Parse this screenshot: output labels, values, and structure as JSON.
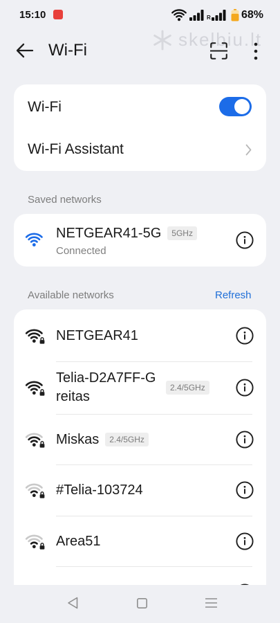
{
  "status_bar": {
    "time": "15:10",
    "roaming_label": "R",
    "battery_text": "68%",
    "battery_level": 0.68,
    "icons": [
      "notification-app-icon",
      "wifi-status-icon",
      "signal-icon",
      "signal-roaming-icon",
      "battery-icon"
    ]
  },
  "watermark": {
    "text": "skelbiu.lt"
  },
  "header": {
    "title": "Wi-Fi",
    "icons": [
      "back-arrow-icon",
      "scan-qr-icon",
      "more-vertical-icon"
    ]
  },
  "wifi_card": {
    "wifi_label": "Wi-Fi",
    "wifi_enabled": true,
    "assistant_label": "Wi-Fi Assistant"
  },
  "saved_networks": {
    "section_label": "Saved networks",
    "networks": [
      {
        "name": "NETGEAR41-5G",
        "band": "5GHz",
        "status": "Connected",
        "signal_level": 4,
        "secured": false
      }
    ]
  },
  "available_networks": {
    "section_label": "Available networks",
    "refresh_label": "Refresh",
    "networks": [
      {
        "name": "NETGEAR41",
        "signal_level": 4,
        "secured": true
      },
      {
        "name": "Telia-D2A7FF-Greitas",
        "band": "2.4/5GHz",
        "signal_level": 4,
        "secured": true
      },
      {
        "name": "Miskas",
        "band": "2.4/5GHz",
        "signal_level": 3,
        "secured": true
      },
      {
        "name": "#Telia-103724",
        "signal_level": 2,
        "secured": true
      },
      {
        "name": "Area51",
        "signal_level": 2,
        "secured": true
      }
    ]
  },
  "nav_bar": {
    "icons": [
      "nav-back-icon",
      "nav-home-icon",
      "nav-recents-icon"
    ]
  },
  "colors": {
    "accent": "#1c6ce8",
    "link": "#1f6fd8",
    "background": "#eff0f4",
    "card": "#ffffff",
    "text_primary": "#1d1d1d",
    "text_secondary": "#7d7d7d",
    "signal_inactive": "#c9c9c9",
    "battery": "#f4a81d",
    "notification": "#e8403b"
  }
}
